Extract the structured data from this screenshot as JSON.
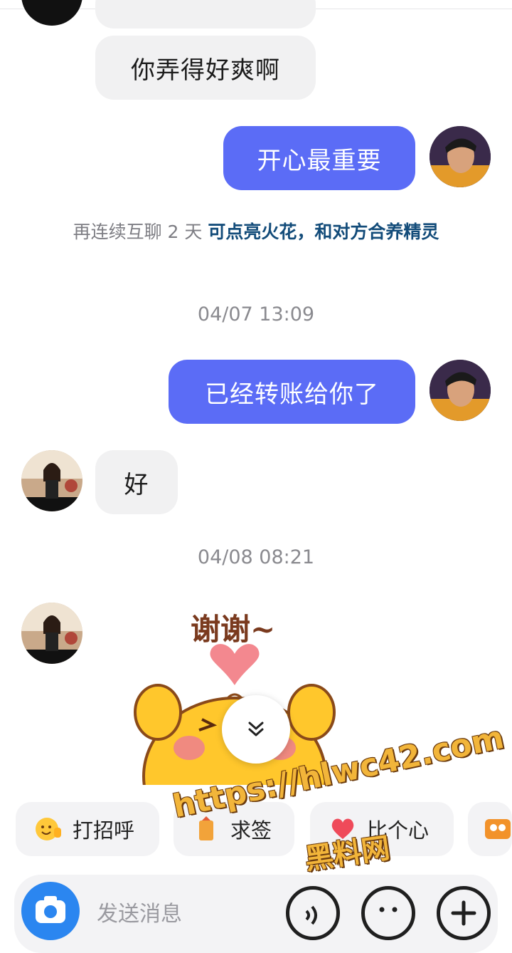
{
  "conversation": {
    "partial_message": "",
    "msg_1": "你弄得好爽啊",
    "msg_2": "开心最重要",
    "spark_hint_prefix": "再连续互聊 2 天 ",
    "spark_hint_link": "可点亮火花，和对方合养精灵",
    "time_1": "04/07 13:09",
    "msg_3": "已经转账给你了",
    "msg_4": "好",
    "time_2": "04/08 08:21",
    "sticker_text": "谢谢~"
  },
  "quick_actions": {
    "greet": "打招呼",
    "ask": "求签",
    "heart": "比个心"
  },
  "input": {
    "placeholder": "发送消息"
  },
  "watermark": {
    "url": "https://hlwc42.com",
    "name": "黑料网"
  },
  "colors": {
    "outgoing_bubble": "#5b6cf6",
    "incoming_bubble": "#f1f1f2",
    "hint_link": "#134c7a"
  },
  "icons": [
    "camera-icon",
    "voice-icon",
    "emoji-icon",
    "plus-icon",
    "scroll-down-icon",
    "smile-hand-icon",
    "fortune-icon",
    "heart-icon",
    "group-icon"
  ]
}
